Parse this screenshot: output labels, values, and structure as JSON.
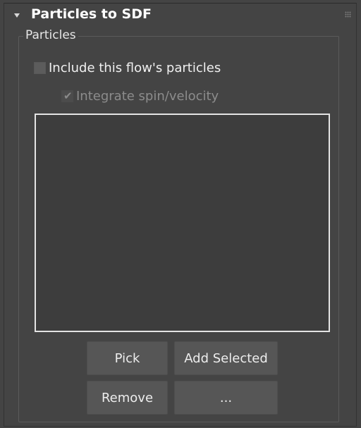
{
  "rollout": {
    "title": "Particles to SDF",
    "collapse_icon": "triangle-down-icon",
    "grip_icon": "drag-grip-icon"
  },
  "group": {
    "label": "Particles"
  },
  "checkboxes": {
    "include_flow": {
      "label": "Include this flow's particles",
      "checked": false,
      "enabled": true
    },
    "integrate_spin": {
      "label": "Integrate spin/velocity",
      "checked": true,
      "enabled": false
    }
  },
  "particle_list": {
    "items": []
  },
  "buttons": {
    "pick": "Pick",
    "add_selected": "Add Selected",
    "remove": "Remove",
    "more": "..."
  },
  "colors": {
    "panel_bg": "#444444",
    "list_bg": "#3d3d3d",
    "list_border": "#e4e4e4",
    "button_bg": "#565656",
    "text": "#e6e6e6",
    "disabled_text": "#8c8c8c"
  }
}
